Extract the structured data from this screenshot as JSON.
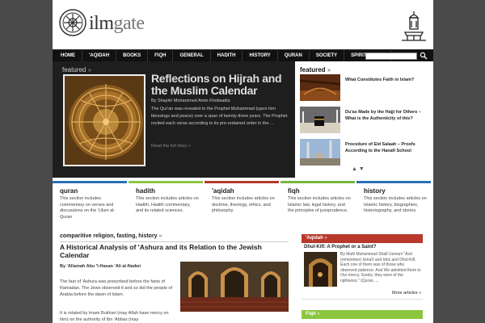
{
  "brand": {
    "logo_main": "ilm",
    "logo_accent": "gate"
  },
  "nav": {
    "items": [
      "HOME",
      "'AQIDAH",
      "BOOKS",
      "FIQH",
      "GENERAL",
      "HADITH",
      "HISTORY",
      "QURAN",
      "SOCIETY",
      "SPIRITUALITY"
    ],
    "search_value": ""
  },
  "featured": {
    "label": "featured",
    "label_arrow": "»",
    "title": "Reflections on Hijrah and the Muslim Calendar",
    "author": "By Shaykh Mohammed Amin Kholwadia",
    "excerpt": "The Qur'an was revealed to the Prophet Muhammad (upon him blessings and peace) over a span of twenty-three years. The Prophet recited each verse according to its pre-ordained order in the ...",
    "read_more": "Read the full story »"
  },
  "featured_list": {
    "label": "featured",
    "label_arrow": "»",
    "items": [
      {
        "title": "What Constitutes Faith in Islam?"
      },
      {
        "title": "Du'as Made by the Hajji for Others – What is the Authenticity of this?"
      },
      {
        "title": "Procedure of Eid Salaah – Proofs According to the Hanafi School"
      }
    ],
    "arrows": "▲ ▼"
  },
  "categories": [
    {
      "title": "quran",
      "desc": "This section includes commentary on verses and discussions on the 'Ulum al-Quran",
      "color": "#2b6fb6"
    },
    {
      "title": "hadith",
      "desc": "This section includes articles on Hadith, Hadith commentary, and its related sciences.",
      "color": "#8cc63f"
    },
    {
      "title": "'aqidah",
      "desc": "This section includes articles on doctrine, theology, ethics, and philosophy.",
      "color": "#b8382c"
    },
    {
      "title": "fiqh",
      "desc": "This section includes articles on Islamic law, legal history, and the principles of jurisprudence.",
      "color": "#7ab63a"
    },
    {
      "title": "history",
      "desc": "This section includes articles on Islamic history, biographies, historiography, and stories.",
      "color": "#2b6fb6"
    }
  ],
  "article": {
    "categories": "comparitive religion, fasting, history",
    "categories_arrow": "»",
    "title": "A Historical Analysis of 'Ashura and its Relation to the Jewish Calendar",
    "author": "By 'Allamah Abu 'l-Hasan 'Ali al-Nadwi",
    "p1": "The fast of 'Ashura was prescribed before the fasts of Ramadan. The Jews observed it and so did the people of Arabia before the dawn of Islam.",
    "p2": "It is related by Imam Bukhari (may Allah have mercy on him) on the authority of Ibn 'Abbas (may"
  },
  "sidebar": {
    "aqidah": {
      "label": "'Aqidah",
      "arrow": "»",
      "title": "Dhul-Kifl: A Prophet or a Saint?",
      "text": "By Mufti Muhammad Shafi Usmani \"And (remember) Isma'il and Idris and Dhul-Kifl. Each one of them was of those who observed patience. And We admitted them to Our mercy. Surely, they were of the righteous.\" (Quran, ...",
      "more": "More articles »"
    },
    "fiqh": {
      "label": "Fiqh",
      "arrow": "»"
    }
  },
  "colors": {
    "accent_red": "#b8382c",
    "accent_green": "#8cc63f",
    "accent_blue": "#2b6fb6"
  }
}
